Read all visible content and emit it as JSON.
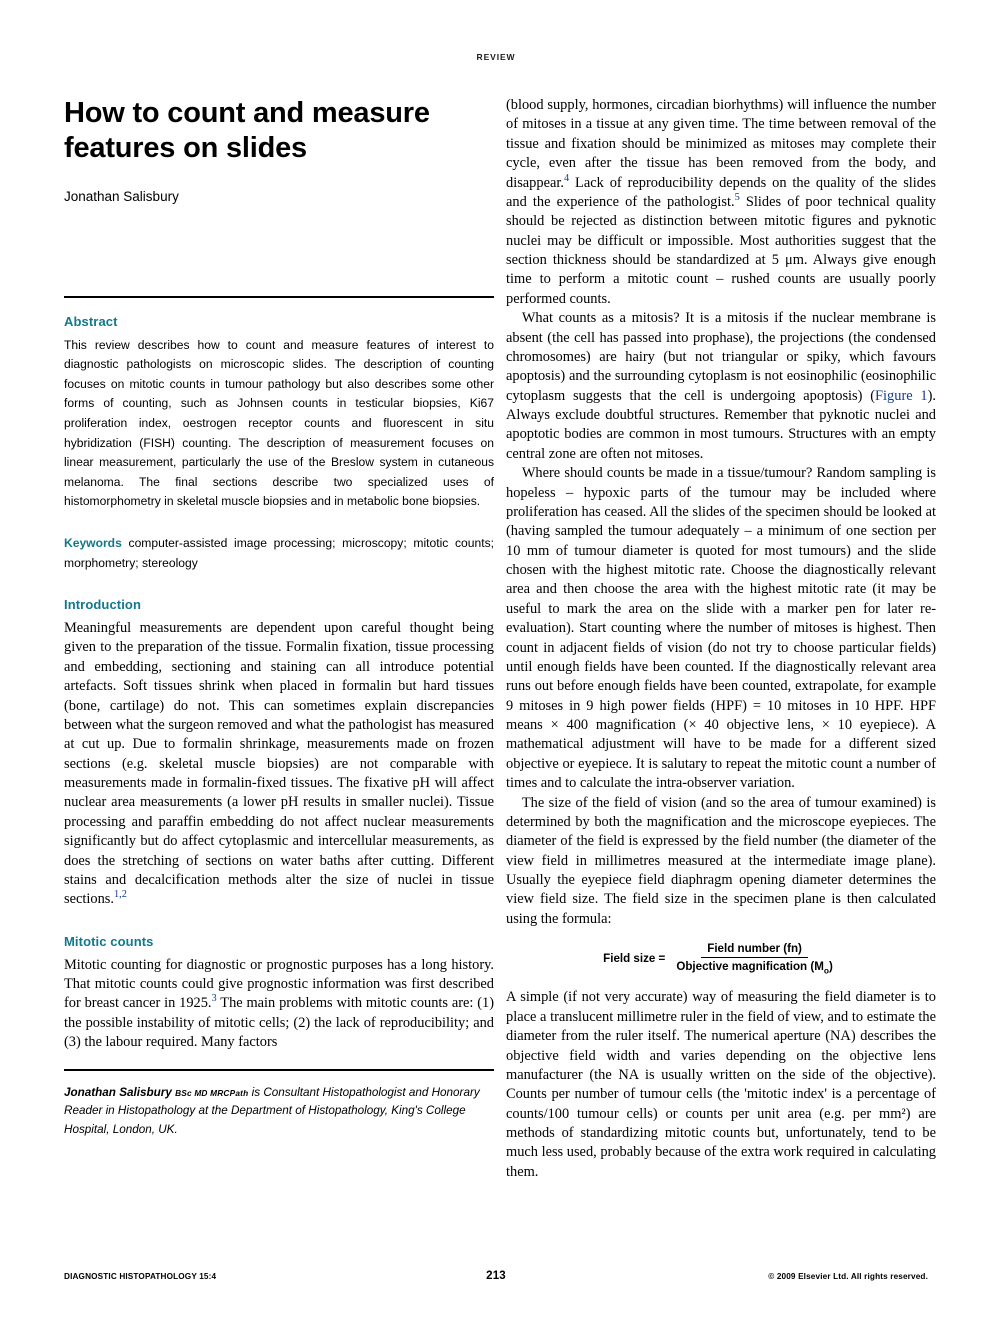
{
  "running_head": "REVIEW",
  "title": {
    "line1": "How to count and measure",
    "line2": "features on slides",
    "author": "Jonathan Salisbury"
  },
  "abstract": {
    "heading": "Abstract",
    "text": "This review describes how to count and measure features of interest to diagnostic pathologists on microscopic slides. The description of counting focuses on mitotic counts in tumour pathology but also describes some other forms of counting, such as Johnsen counts in testicular biopsies, Ki67 proliferation index, oestrogen receptor counts and fluorescent in situ hybridization (FISH) counting. The description of measurement focuses on linear measurement, particularly the use of the Breslow system in cutaneous melanoma. The final sections describe two specialized uses of histomorphometry in skeletal muscle biopsies and in metabolic bone biopsies."
  },
  "keywords": {
    "label": "Keywords",
    "text": "computer-assisted image processing; microscopy; mitotic counts; morphometry; stereology"
  },
  "introduction": {
    "heading": "Introduction",
    "paragraph": "Meaningful measurements are dependent upon careful thought being given to the preparation of the tissue. Formalin fixation, tissue processing and embedding, sectioning and staining can all introduce potential artefacts. Soft tissues shrink when placed in formalin but hard tissues (bone, cartilage) do not. This can sometimes explain discrepancies between what the surgeon removed and what the pathologist has measured at cut up. Due to formalin shrinkage, measurements made on frozen sections (e.g. skeletal muscle biopsies) are not comparable with measurements made in formalin-fixed tissues. The fixative pH will affect nuclear area measurements (a lower pH results in smaller nuclei). Tissue processing and paraffin embedding do not affect nuclear measurements significantly but do affect cytoplasmic and intercellular measurements, as does the stretching of sections on water baths after cutting. Different stains and decalcification methods alter the size of nuclei in tissue sections.",
    "citation": "1,2"
  },
  "mitotic_counts": {
    "heading": "Mitotic counts",
    "paragraph_a": "Mitotic counting for diagnostic or prognostic purposes has a long history. That mitotic counts could give prognostic information was first described for breast cancer in 1925.",
    "citation_a": "3",
    "paragraph_b": " The main problems with mitotic counts are: (1) the possible instability of mitotic cells; (2) the lack of reproducibility; and (3) the labour required. Many factors"
  },
  "bio": {
    "name": "Jonathan Salisbury",
    "degrees": "BSc MD MRCPath",
    "text": " is Consultant Histopathologist and Honorary Reader in Histopathology at the Department of Histopathology, King's College Hospital, London, UK."
  },
  "right_column": {
    "p1_a": "(blood supply, hormones, circadian biorhythms) will influence the number of mitoses in a tissue at any given time. The time between removal of the tissue and fixation should be minimized as mitoses may complete their cycle, even after the tissue has been removed from the body, and disappear.",
    "p1_ref1": "4",
    "p1_b": " Lack of reproducibility depends on the quality of the slides and the experience of the pathologist.",
    "p1_ref2": "5",
    "p1_c": " Slides of poor technical quality should be rejected as distinction between mitotic figures and pyknotic nuclei may be difficult or impossible. Most authorities suggest that the section thickness should be standardized at 5 μm. Always give enough time to perform a mitotic count – rushed counts are usually poorly performed counts.",
    "p2_a": "What counts as a mitosis? It is a mitosis if the nuclear membrane is absent (the cell has passed into prophase), the projections (the condensed chromosomes) are hairy (but not triangular or spiky, which favours apoptosis) and the surrounding cytoplasm is not eosinophilic (eosinophilic cytoplasm suggests that the cell is undergoing apoptosis) (",
    "p2_figlink": "Figure 1",
    "p2_b": "). Always exclude doubtful structures. Remember that pyknotic nuclei and apoptotic bodies are common in most tumours. Structures with an empty central zone are often not mitoses.",
    "p3": "Where should counts be made in a tissue/tumour? Random sampling is hopeless – hypoxic parts of the tumour may be included where proliferation has ceased. All the slides of the specimen should be looked at (having sampled the tumour adequately – a minimum of one section per 10 mm of tumour diameter is quoted for most tumours) and the slide chosen with the highest mitotic rate. Choose the diagnostically relevant area and then choose the area with the highest mitotic rate (it may be useful to mark the area on the slide with a marker pen for later re-evaluation). Start counting where the number of mitoses is highest. Then count in adjacent fields of vision (do not try to choose particular fields) until enough fields have been counted. If the diagnostically relevant area runs out before enough fields have been counted, extrapolate, for example 9 mitoses in 9 high power fields (HPF) = 10 mitoses in 10 HPF. HPF means × 400 magnification (× 40 objective lens, × 10 eyepiece). A mathematical adjustment will have to be made for a different sized objective or eyepiece. It is salutary to repeat the mitotic count a number of times and to calculate the intra-observer variation.",
    "p4": "The size of the field of vision (and so the area of tumour examined) is determined by both the magnification and the microscope eyepieces. The diameter of the field is expressed by the field number (the diameter of the view field in millimetres measured at the intermediate image plane). Usually the eyepiece field diaphragm opening diameter determines the view field size. The field size in the specimen plane is then calculated using the formula:",
    "formula": {
      "lhs": "Field size =",
      "numerator": "Field number (fn)",
      "denominator": "Objective magnification (M",
      "denominator_sub": "o",
      "denominator_end": ")"
    },
    "p5": "A simple (if not very accurate) way of measuring the field diameter is to place a translucent millimetre ruler in the field of view, and to estimate the diameter from the ruler itself. The numerical aperture (NA) describes the objective field width and varies depending on the objective lens manufacturer (the NA is usually written on the side of the objective). Counts per number of tumour cells (the 'mitotic index' is a percentage of counts/100 tumour cells) or counts per unit area (e.g. per mm²) are methods of standardizing mitotic counts but, unfortunately, tend to be much less used, probably because of the extra work required in calculating them."
  },
  "footer": {
    "journal": "DIAGNOSTIC HISTOPATHOLOGY 15:4",
    "page": "213",
    "copyright": "© 2009 Elsevier Ltd. All rights reserved."
  },
  "colors": {
    "heading_teal": "#13788b",
    "link_blue": "#123e8c"
  }
}
